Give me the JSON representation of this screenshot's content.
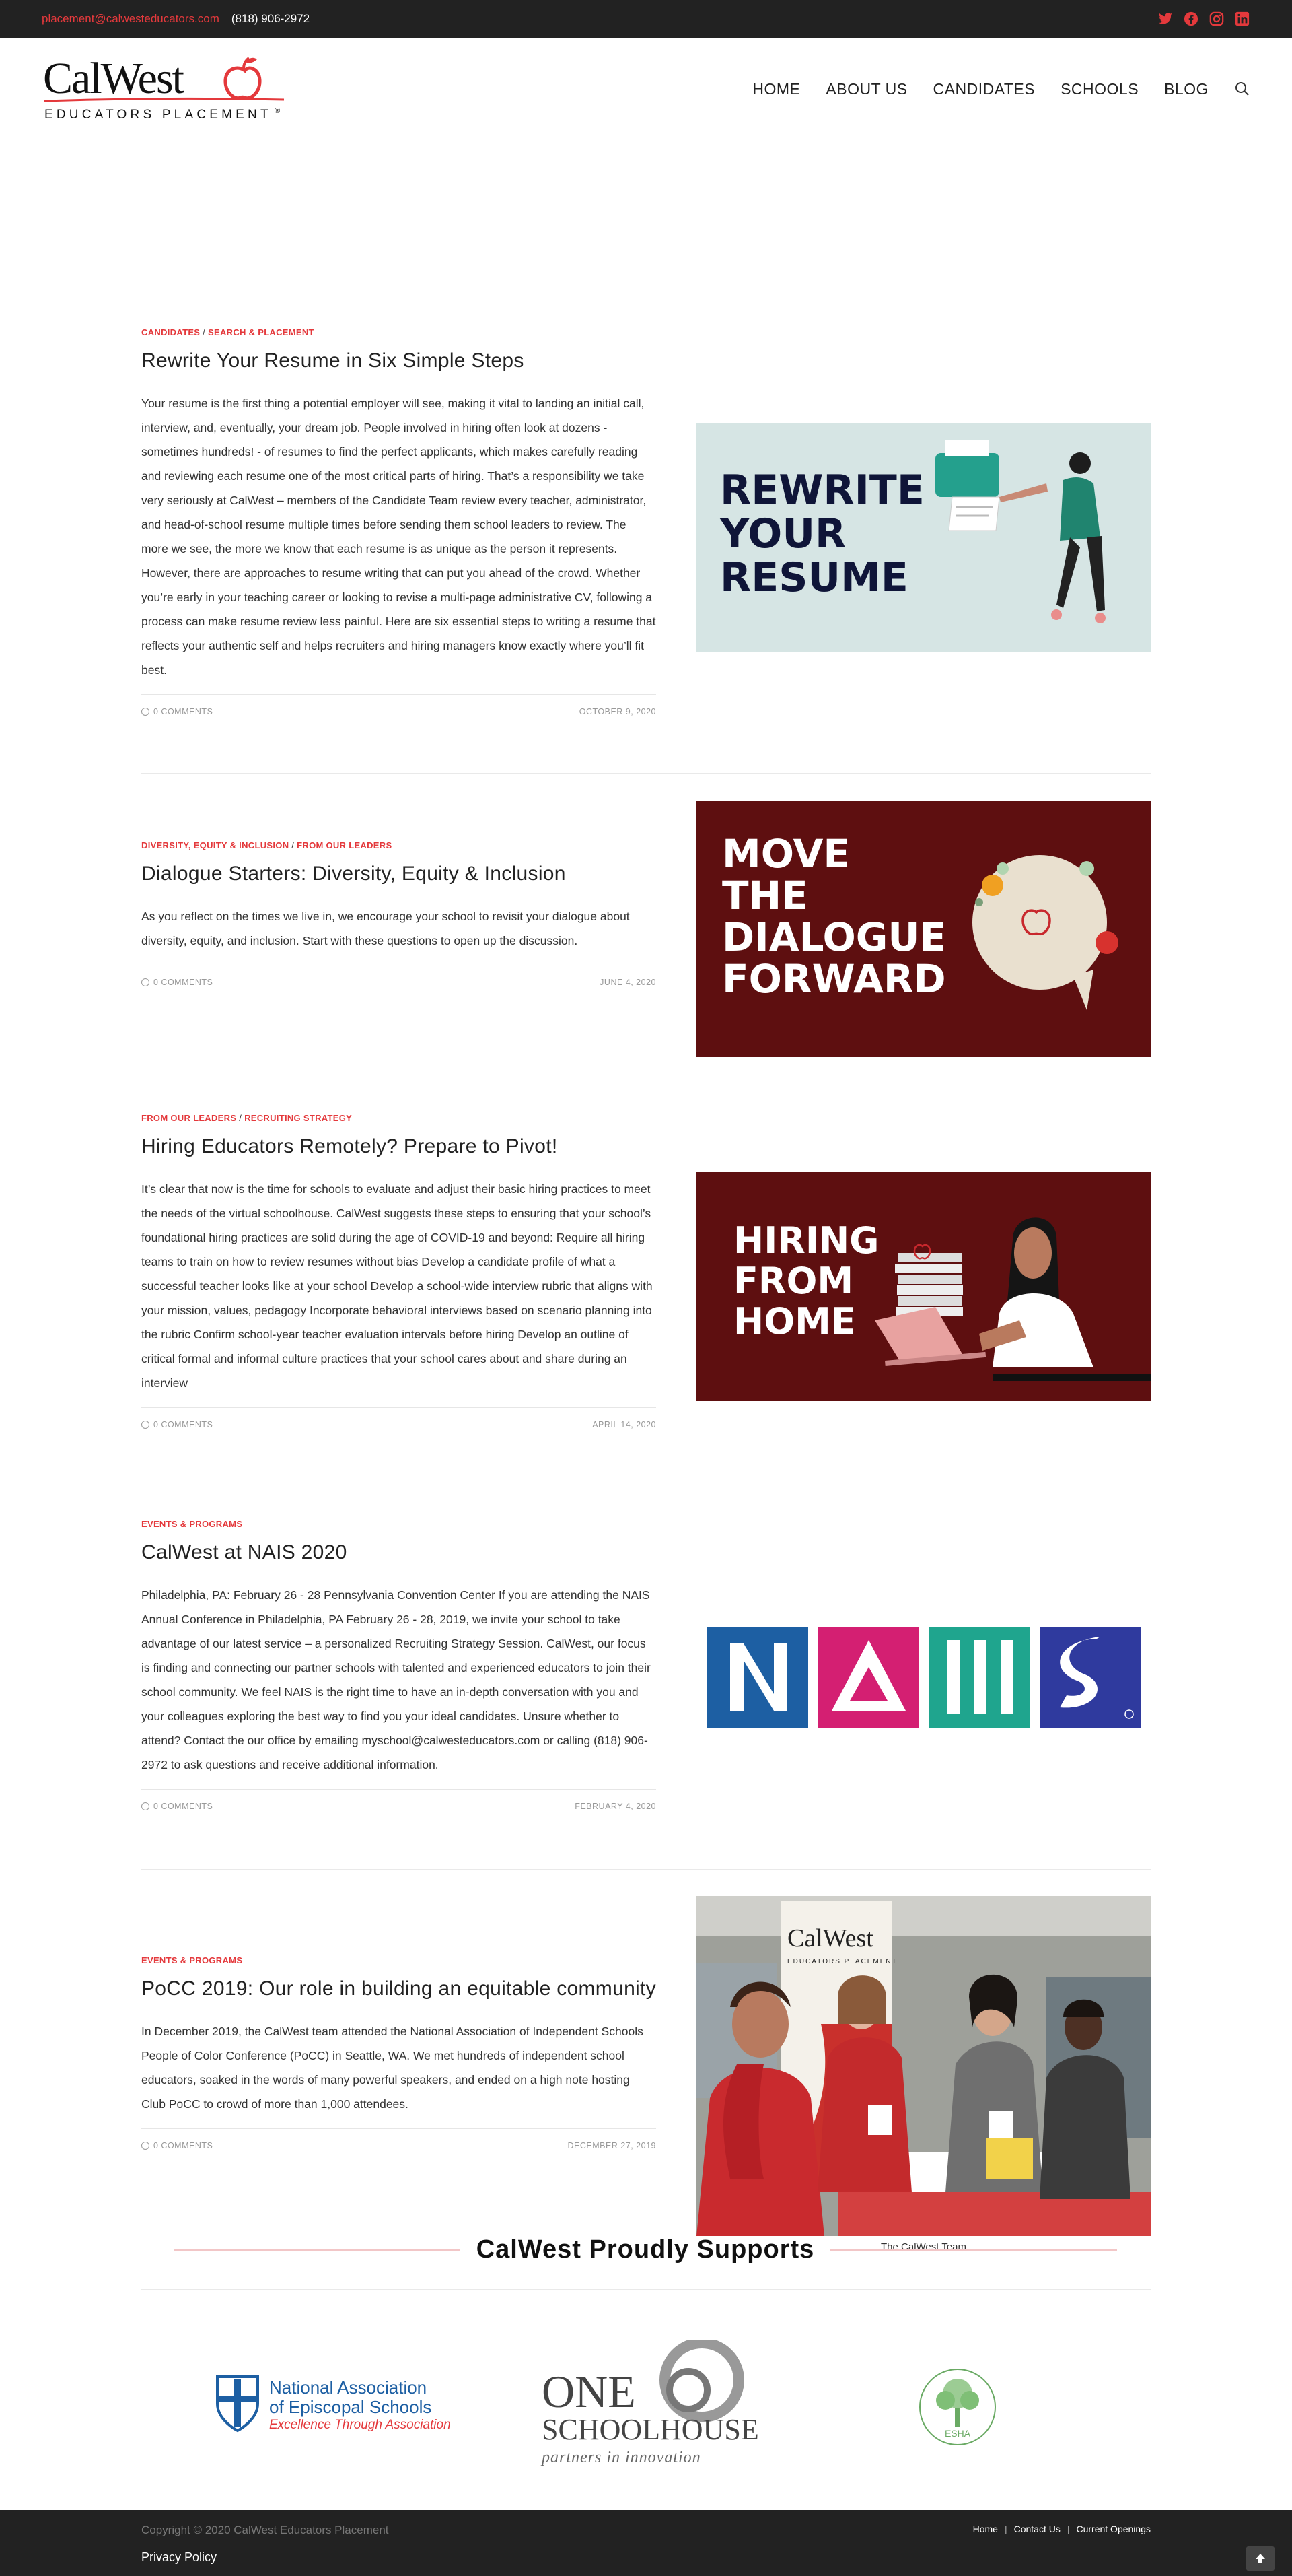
{
  "topbar": {
    "email": "placement@calwesteducators.com",
    "phone": "(818) 906-2972",
    "social": [
      "twitter-icon",
      "facebook-icon",
      "instagram-icon",
      "linkedin-icon"
    ]
  },
  "logo": {
    "name": "CalWest",
    "tagline": "EDUCATORS PLACEMENT"
  },
  "nav": {
    "items": [
      "HOME",
      "ABOUT US",
      "CANDIDATES",
      "SCHOOLS",
      "BLOG"
    ]
  },
  "posts": [
    {
      "cat1": "CANDIDATES",
      "cat2": "SEARCH & PLACEMENT",
      "title": "Rewrite Your Resume in Six Simple Steps",
      "excerpt": "Your resume is the first thing a potential employer will see, making it vital to landing an initial call, interview, and, eventually, your dream job. People involved in hiring often look at dozens - sometimes hundreds! - of resumes to find the perfect applicants, which makes carefully reading and reviewing each resume one of the most critical parts of hiring. That’s a responsibility we take very seriously at CalWest – members of the Candidate Team review every teacher, administrator, and head-of-school resume multiple times before sending them school leaders to review. The more we see, the more we know that each resume is as unique as the person it represents. However, there are approaches to resume writing that can put you ahead of the crowd. Whether you’re early in your teaching career or looking to revise a multi-page administrative CV, following a process can make resume review less painful. Here are six essential steps to writing a resume that reflects your authentic self and helps recruiters and hiring managers know exactly where you’ll fit best.",
      "comments": "0 COMMENTS",
      "date": "OCTOBER 9, 2020",
      "image_text": [
        "REWRITE",
        "YOUR",
        "RESUME"
      ]
    },
    {
      "cat1": "DIVERSITY, EQUITY & INCLUSION",
      "cat2": "FROM OUR LEADERS",
      "title": "Dialogue Starters: Diversity, Equity & Inclusion",
      "excerpt": "As you reflect on the times we live in, we encourage your school to revisit your dialogue about diversity, equity, and inclusion. Start with these questions to open up the discussion.",
      "comments": "0 COMMENTS",
      "date": "JUNE 4, 2020",
      "image_text": [
        "MOVE",
        "THE",
        "DIALOGUE",
        "FORWARD"
      ]
    },
    {
      "cat1": "FROM OUR LEADERS",
      "cat2": "RECRUITING STRATEGY",
      "title": "Hiring Educators Remotely? Prepare to Pivot!",
      "excerpt": "It’s clear that now is the time for schools to evaluate and adjust their basic hiring practices to meet the needs of the virtual schoolhouse.  CalWest suggests these steps to ensuring that your school’s foundational hiring practices are solid during the age of COVID-19 and beyond: Require all hiring teams to train on how to review resumes without bias Develop a candidate profile of what a successful teacher looks like at your school Develop a school-wide interview rubric that aligns with your mission, values, pedagogy Incorporate behavioral interviews based on scenario planning into the rubric Confirm school-year teacher evaluation intervals before hiring Develop an outline of critical formal and informal culture practices that your school cares about and share during an interview",
      "comments": "0 COMMENTS",
      "date": "APRIL 14, 2020",
      "image_text": [
        "HIRING",
        "FROM",
        "HOME"
      ]
    },
    {
      "cat1": "EVENTS & PROGRAMS",
      "cat2": "",
      "title": "CalWest at NAIS 2020",
      "excerpt": "Philadelphia, PA: February 26 - 28 Pennsylvania Convention Center If you are attending the NAIS Annual Conference in Philadelphia, PA February 26 - 28, 2019, we invite your school to take advantage of our latest service – a personalized Recruiting Strategy Session. CalWest, our focus is finding and connecting our partner schools with talented and experienced educators to join their school community. We feel NAIS is the right time to have an in-depth conversation with you and your colleagues exploring the best way to find you your ideal candidates. Unsure whether to attend?  Contact the our office by emailing myschool@calwesteducators.com or calling (818) 906-2972 to ask questions and receive additional information.",
      "comments": "0 COMMENTS",
      "date": "FEBRUARY 4, 2020",
      "image_text": []
    },
    {
      "cat1": "EVENTS & PROGRAMS",
      "cat2": "",
      "title": "PoCC 2019: Our role in building an equitable community",
      "excerpt": "In December 2019, the CalWest team attended the National Association of Independent Schools People of Color Conference (PoCC) in Seattle, WA. We met hundreds of independent school educators, soaked in the words of many powerful speakers, and ended on a high note hosting Club PoCC to crowd of more than 1,000 attendees.",
      "comments": "0 COMMENTS",
      "date": "DECEMBER 27, 2019",
      "caption": "The CalWest Team",
      "banner_name": "CalWest",
      "banner_tag": "EDUCATORS PLACEMENT"
    }
  ],
  "supports": {
    "title": "CalWest Proudly Supports",
    "nais": {
      "line1": "National Association",
      "line2": "of Episcopal Schools",
      "line3": "Excellence Through Association"
    },
    "one": {
      "line1": "ONE",
      "line2": "SCHOOLHOUSE",
      "line3": "partners in innovation"
    },
    "esha": {
      "label": "ESHA"
    }
  },
  "footer": {
    "copyright": "Copyright © 2020 CalWest Educators Placement",
    "privacy": "Privacy Policy",
    "links": [
      "Home",
      "Contact Us",
      "Current Openings"
    ]
  },
  "colors": {
    "accent": "#e4393c",
    "dark": "#222222",
    "maroon": "#5e0f10",
    "mint": "#d6e5e4"
  }
}
